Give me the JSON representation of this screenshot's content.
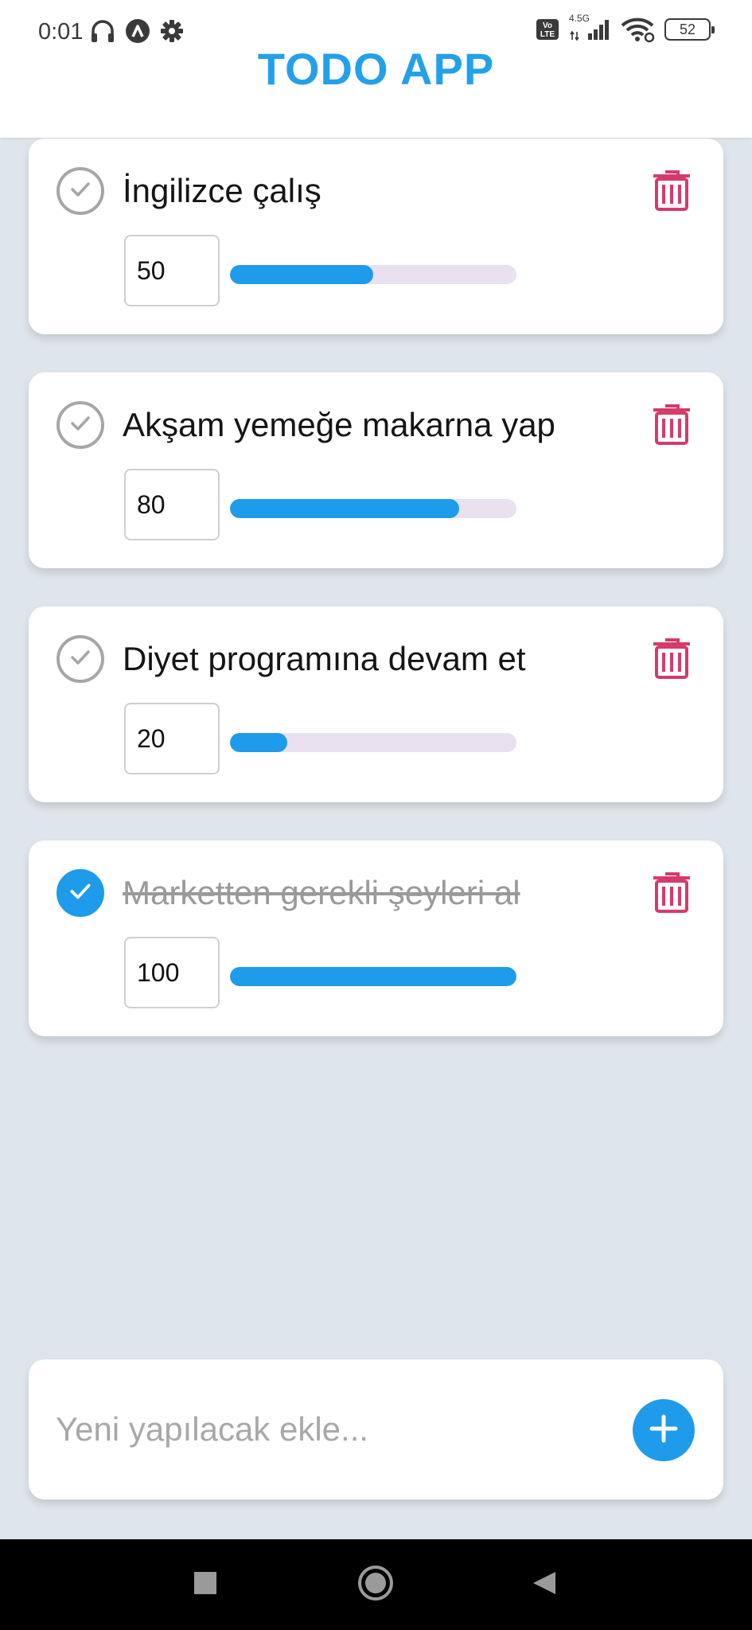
{
  "status_bar": {
    "time": "0:01",
    "network_label": "4.5G",
    "volte_label": "Vo LTE",
    "battery": "52"
  },
  "header": {
    "title": "TODO APP"
  },
  "todos": [
    {
      "title": "İngilizce çalış",
      "progress": "50",
      "progress_percent": 50,
      "done": false
    },
    {
      "title": "Akşam yemeğe makarna yap",
      "progress": "80",
      "progress_percent": 80,
      "done": false
    },
    {
      "title": "Diyet programına devam et",
      "progress": "20",
      "progress_percent": 20,
      "done": false
    },
    {
      "title": "Marketten gerekli şeyleri al",
      "progress": "100",
      "progress_percent": 100,
      "done": true
    }
  ],
  "add_bar": {
    "placeholder": "Yeni yapılacak ekle..."
  },
  "icons": {
    "check": "check-circle-icon",
    "delete": "trash-icon",
    "add": "plus-icon",
    "nav": [
      "recents-square-icon",
      "home-circle-icon",
      "back-triangle-icon"
    ]
  },
  "colors": {
    "accent": "#1e9bea",
    "title": "#23a0ea",
    "delete": "#d63a6b",
    "background": "#dfe5ec",
    "track": "#e9e1ef"
  }
}
